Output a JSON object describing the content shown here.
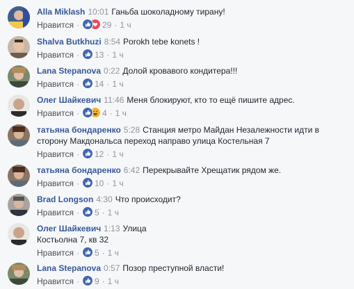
{
  "labels": {
    "like": "Нравится"
  },
  "colors": {
    "name": "#365899",
    "meta": "#90949c",
    "like_blue": "#4267b2",
    "love_red": "#ed4956",
    "haha_yellow": "#f7b125"
  },
  "comments": [
    {
      "name": "Alla Miklash",
      "time": "10:01",
      "text": "Ганьба шоколадному тирану!",
      "text2": "",
      "reactions": [
        "like",
        "love"
      ],
      "count": "29",
      "ago": "1 ч"
    },
    {
      "name": "Shalva Butkhuzi",
      "time": "8:54",
      "text": "Porokh tebe konets !",
      "text2": "",
      "reactions": [
        "like"
      ],
      "count": "13",
      "ago": "1 ч"
    },
    {
      "name": "Lana Stepanova",
      "time": "0:22",
      "text": "Долой кровавого кондитера!!!",
      "text2": "",
      "reactions": [
        "like"
      ],
      "count": "14",
      "ago": "1 ч"
    },
    {
      "name": "Олег Шайкевич",
      "time": "11:46",
      "text": "Меня блокируют, кто то ещё пишите адрес.",
      "text2": "",
      "reactions": [
        "like",
        "haha"
      ],
      "count": "4",
      "ago": "1 ч"
    },
    {
      "name": "татьяна бондаренко",
      "time": "5:28",
      "text": "Станция метро Майдан Незалежности идти в",
      "text2": "сторону Макдональса переход направо улица Костельная 7",
      "reactions": [
        "like"
      ],
      "count": "12",
      "ago": "1 ч"
    },
    {
      "name": "татьяна бондаренко",
      "time": "6:42",
      "text": "Перекрывайте Хрещатик рядом же.",
      "text2": "",
      "reactions": [
        "like"
      ],
      "count": "10",
      "ago": "1 ч"
    },
    {
      "name": "Brad Longson",
      "time": "4:30",
      "text": "Что происходит?",
      "text2": "",
      "reactions": [
        "like"
      ],
      "count": "5",
      "ago": "1 ч"
    },
    {
      "name": "Олег Шайкевич",
      "time": "1:13",
      "text": "Улица",
      "text2": "Костьолна 7, кв 32",
      "reactions": [
        "like"
      ],
      "count": "5",
      "ago": "1 ч"
    },
    {
      "name": "Lana Stepanova",
      "time": "0:57",
      "text": "Позор преступной власти!",
      "text2": "",
      "reactions": [
        "like"
      ],
      "count": "9",
      "ago": "1 ч"
    }
  ]
}
